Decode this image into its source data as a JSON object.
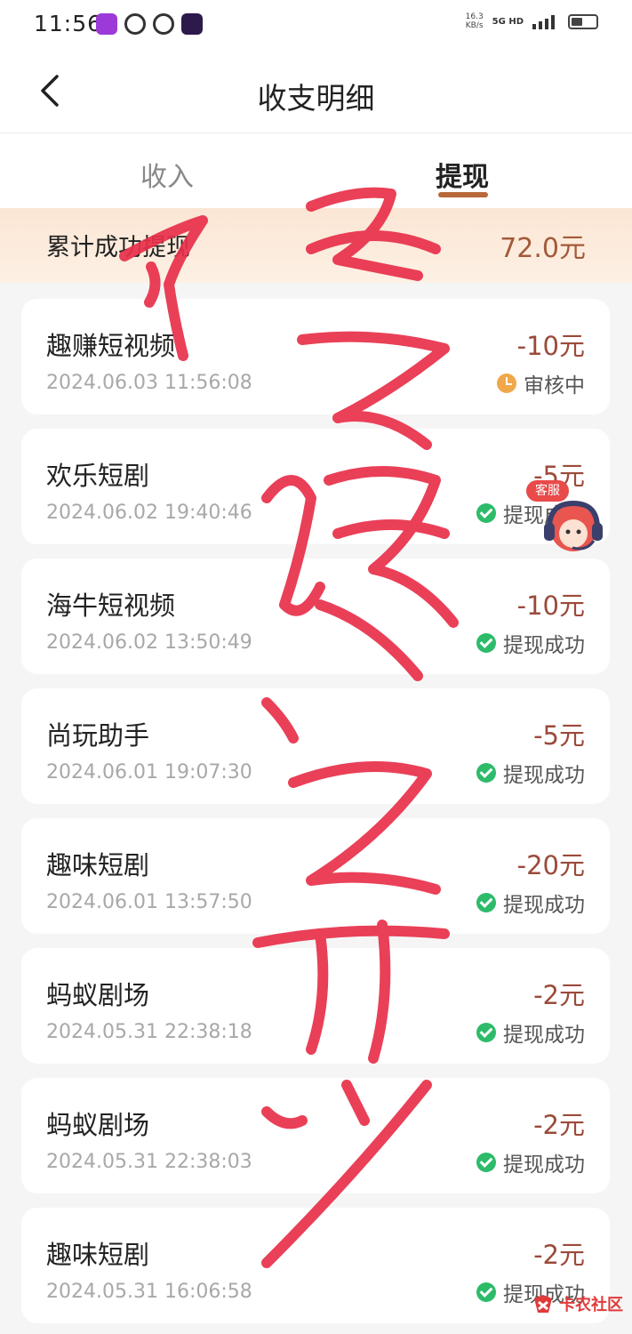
{
  "status_bar": {
    "time": "11:56",
    "net_speed_value": "16.3",
    "net_speed_unit": "KB/s",
    "network_type": "5G HD",
    "battery_level": 0.45
  },
  "header": {
    "title": "收支明细"
  },
  "tabs": [
    {
      "label": "收入",
      "active": false
    },
    {
      "label": "提现",
      "active": true
    }
  ],
  "summary": {
    "label": "累计成功提现",
    "value": "72.0元"
  },
  "records": [
    {
      "title": "趣赚短视频",
      "time": "2024.06.03 11:56:08",
      "amount": "-10元",
      "status": "审核中",
      "status_icon": "clock-icon"
    },
    {
      "title": "欢乐短剧",
      "time": "2024.06.02 19:40:46",
      "amount": "-5元",
      "status": "提现成功",
      "status_icon": "check-icon"
    },
    {
      "title": "海牛短视频",
      "time": "2024.06.02 13:50:49",
      "amount": "-10元",
      "status": "提现成功",
      "status_icon": "check-icon"
    },
    {
      "title": "尚玩助手",
      "time": "2024.06.01 19:07:30",
      "amount": "-5元",
      "status": "提现成功",
      "status_icon": "check-icon"
    },
    {
      "title": "趣味短剧",
      "time": "2024.06.01 13:57:50",
      "amount": "-20元",
      "status": "提现成功",
      "status_icon": "check-icon"
    },
    {
      "title": "蚂蚁剧场",
      "time": "2024.05.31 22:38:18",
      "amount": "-2元",
      "status": "提现成功",
      "status_icon": "check-icon"
    },
    {
      "title": "蚂蚁剧场",
      "time": "2024.05.31 22:38:03",
      "amount": "-2元",
      "status": "提现成功",
      "status_icon": "check-icon"
    },
    {
      "title": "趣味短剧",
      "time": "2024.05.31 16:06:58",
      "amount": "-2元",
      "status": "提现成功",
      "status_icon": "check-icon"
    }
  ],
  "customer_service": {
    "label": "客服"
  },
  "watermark": {
    "text": "卡农社区"
  },
  "colors": {
    "accent": "#b7693a",
    "amount": "#9b4a3a",
    "success": "#2dbb6a",
    "pending": "#f0a84a",
    "scribble": "#e8304a"
  }
}
